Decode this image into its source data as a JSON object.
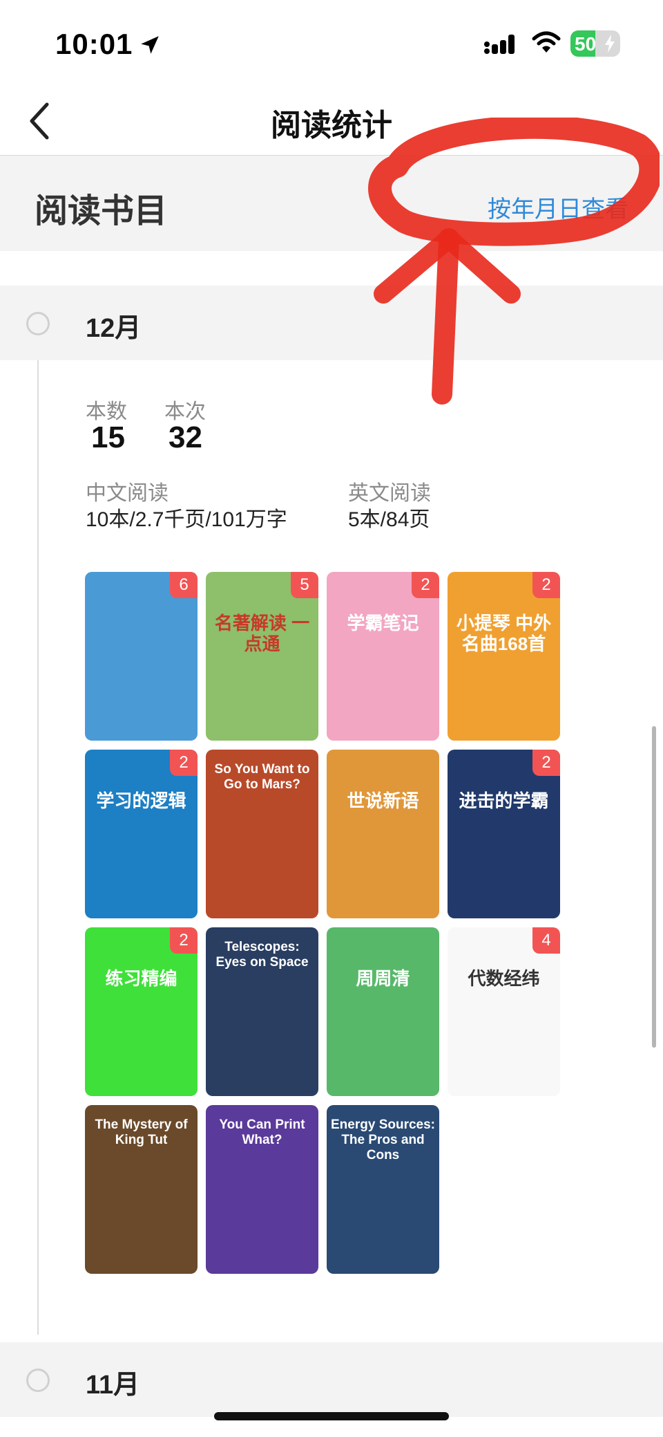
{
  "status_bar": {
    "time": "10:01",
    "battery": "50",
    "battery_level": 0.5
  },
  "nav": {
    "title": "阅读统计"
  },
  "section": {
    "title": "阅读书目",
    "view_by_date": "按年月日查看"
  },
  "months": [
    {
      "label": "12月",
      "stats": {
        "books_label": "本数",
        "books_value": "15",
        "times_label": "本次",
        "times_value": "32"
      },
      "chinese": {
        "label": "中文阅读",
        "value": "10本/2.7千页/101万字"
      },
      "english": {
        "label": "英文阅读",
        "value": "5本/84页"
      },
      "books": [
        {
          "title": "",
          "badge": "6",
          "bg": "#4a9ad6"
        },
        {
          "title": "名著解读 一点通",
          "badge": "5",
          "bg": "#8ebf6a"
        },
        {
          "title": "学霸笔记",
          "badge": "2",
          "bg": "#f2a6c2"
        },
        {
          "title": "小提琴 中外名曲168首",
          "badge": "2",
          "bg": "#f0a030"
        },
        {
          "title": "学习的逻辑",
          "badge": "2",
          "bg": "#1d7fc4"
        },
        {
          "title": "So You Want to Go to Mars?",
          "badge": "",
          "bg": "#b84a2a"
        },
        {
          "title": "世说新语",
          "badge": "",
          "bg": "#e0973a"
        },
        {
          "title": "进击的学霸",
          "badge": "2",
          "bg": "#213a6b"
        },
        {
          "title": "练习精编",
          "badge": "2",
          "bg": "#3fe03a"
        },
        {
          "title": "Telescopes: Eyes on Space",
          "badge": "",
          "bg": "#2a3e62"
        },
        {
          "title": "周周清",
          "badge": "",
          "bg": "#58b86a"
        },
        {
          "title": "代数经纬",
          "badge": "4",
          "bg": "#f8f8f8"
        },
        {
          "title": "The Mystery of King Tut",
          "badge": "",
          "bg": "#6a4a2a"
        },
        {
          "title": "You Can Print What?",
          "badge": "",
          "bg": "#5a3a9a"
        },
        {
          "title": "Energy Sources: The Pros and Cons",
          "badge": "",
          "bg": "#2a4a74"
        }
      ]
    },
    {
      "label": "11月"
    }
  ],
  "colors": {
    "accent": "#2f8ad9",
    "badge": "#f25454",
    "annotation": "#e8291c"
  }
}
